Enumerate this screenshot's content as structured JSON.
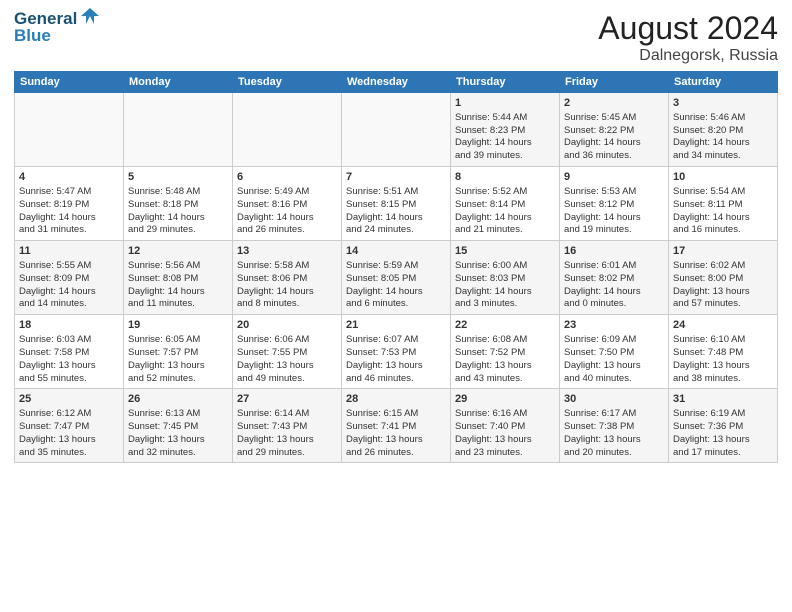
{
  "header": {
    "logo_line1": "General",
    "logo_line2": "Blue",
    "month": "August 2024",
    "location": "Dalnegorsk, Russia"
  },
  "weekdays": [
    "Sunday",
    "Monday",
    "Tuesday",
    "Wednesday",
    "Thursday",
    "Friday",
    "Saturday"
  ],
  "weeks": [
    [
      {
        "day": "",
        "info": ""
      },
      {
        "day": "",
        "info": ""
      },
      {
        "day": "",
        "info": ""
      },
      {
        "day": "",
        "info": ""
      },
      {
        "day": "1",
        "info": "Sunrise: 5:44 AM\nSunset: 8:23 PM\nDaylight: 14 hours\nand 39 minutes."
      },
      {
        "day": "2",
        "info": "Sunrise: 5:45 AM\nSunset: 8:22 PM\nDaylight: 14 hours\nand 36 minutes."
      },
      {
        "day": "3",
        "info": "Sunrise: 5:46 AM\nSunset: 8:20 PM\nDaylight: 14 hours\nand 34 minutes."
      }
    ],
    [
      {
        "day": "4",
        "info": "Sunrise: 5:47 AM\nSunset: 8:19 PM\nDaylight: 14 hours\nand 31 minutes."
      },
      {
        "day": "5",
        "info": "Sunrise: 5:48 AM\nSunset: 8:18 PM\nDaylight: 14 hours\nand 29 minutes."
      },
      {
        "day": "6",
        "info": "Sunrise: 5:49 AM\nSunset: 8:16 PM\nDaylight: 14 hours\nand 26 minutes."
      },
      {
        "day": "7",
        "info": "Sunrise: 5:51 AM\nSunset: 8:15 PM\nDaylight: 14 hours\nand 24 minutes."
      },
      {
        "day": "8",
        "info": "Sunrise: 5:52 AM\nSunset: 8:14 PM\nDaylight: 14 hours\nand 21 minutes."
      },
      {
        "day": "9",
        "info": "Sunrise: 5:53 AM\nSunset: 8:12 PM\nDaylight: 14 hours\nand 19 minutes."
      },
      {
        "day": "10",
        "info": "Sunrise: 5:54 AM\nSunset: 8:11 PM\nDaylight: 14 hours\nand 16 minutes."
      }
    ],
    [
      {
        "day": "11",
        "info": "Sunrise: 5:55 AM\nSunset: 8:09 PM\nDaylight: 14 hours\nand 14 minutes."
      },
      {
        "day": "12",
        "info": "Sunrise: 5:56 AM\nSunset: 8:08 PM\nDaylight: 14 hours\nand 11 minutes."
      },
      {
        "day": "13",
        "info": "Sunrise: 5:58 AM\nSunset: 8:06 PM\nDaylight: 14 hours\nand 8 minutes."
      },
      {
        "day": "14",
        "info": "Sunrise: 5:59 AM\nSunset: 8:05 PM\nDaylight: 14 hours\nand 6 minutes."
      },
      {
        "day": "15",
        "info": "Sunrise: 6:00 AM\nSunset: 8:03 PM\nDaylight: 14 hours\nand 3 minutes."
      },
      {
        "day": "16",
        "info": "Sunrise: 6:01 AM\nSunset: 8:02 PM\nDaylight: 14 hours\nand 0 minutes."
      },
      {
        "day": "17",
        "info": "Sunrise: 6:02 AM\nSunset: 8:00 PM\nDaylight: 13 hours\nand 57 minutes."
      }
    ],
    [
      {
        "day": "18",
        "info": "Sunrise: 6:03 AM\nSunset: 7:58 PM\nDaylight: 13 hours\nand 55 minutes."
      },
      {
        "day": "19",
        "info": "Sunrise: 6:05 AM\nSunset: 7:57 PM\nDaylight: 13 hours\nand 52 minutes."
      },
      {
        "day": "20",
        "info": "Sunrise: 6:06 AM\nSunset: 7:55 PM\nDaylight: 13 hours\nand 49 minutes."
      },
      {
        "day": "21",
        "info": "Sunrise: 6:07 AM\nSunset: 7:53 PM\nDaylight: 13 hours\nand 46 minutes."
      },
      {
        "day": "22",
        "info": "Sunrise: 6:08 AM\nSunset: 7:52 PM\nDaylight: 13 hours\nand 43 minutes."
      },
      {
        "day": "23",
        "info": "Sunrise: 6:09 AM\nSunset: 7:50 PM\nDaylight: 13 hours\nand 40 minutes."
      },
      {
        "day": "24",
        "info": "Sunrise: 6:10 AM\nSunset: 7:48 PM\nDaylight: 13 hours\nand 38 minutes."
      }
    ],
    [
      {
        "day": "25",
        "info": "Sunrise: 6:12 AM\nSunset: 7:47 PM\nDaylight: 13 hours\nand 35 minutes."
      },
      {
        "day": "26",
        "info": "Sunrise: 6:13 AM\nSunset: 7:45 PM\nDaylight: 13 hours\nand 32 minutes."
      },
      {
        "day": "27",
        "info": "Sunrise: 6:14 AM\nSunset: 7:43 PM\nDaylight: 13 hours\nand 29 minutes."
      },
      {
        "day": "28",
        "info": "Sunrise: 6:15 AM\nSunset: 7:41 PM\nDaylight: 13 hours\nand 26 minutes."
      },
      {
        "day": "29",
        "info": "Sunrise: 6:16 AM\nSunset: 7:40 PM\nDaylight: 13 hours\nand 23 minutes."
      },
      {
        "day": "30",
        "info": "Sunrise: 6:17 AM\nSunset: 7:38 PM\nDaylight: 13 hours\nand 20 minutes."
      },
      {
        "day": "31",
        "info": "Sunrise: 6:19 AM\nSunset: 7:36 PM\nDaylight: 13 hours\nand 17 minutes."
      }
    ]
  ]
}
